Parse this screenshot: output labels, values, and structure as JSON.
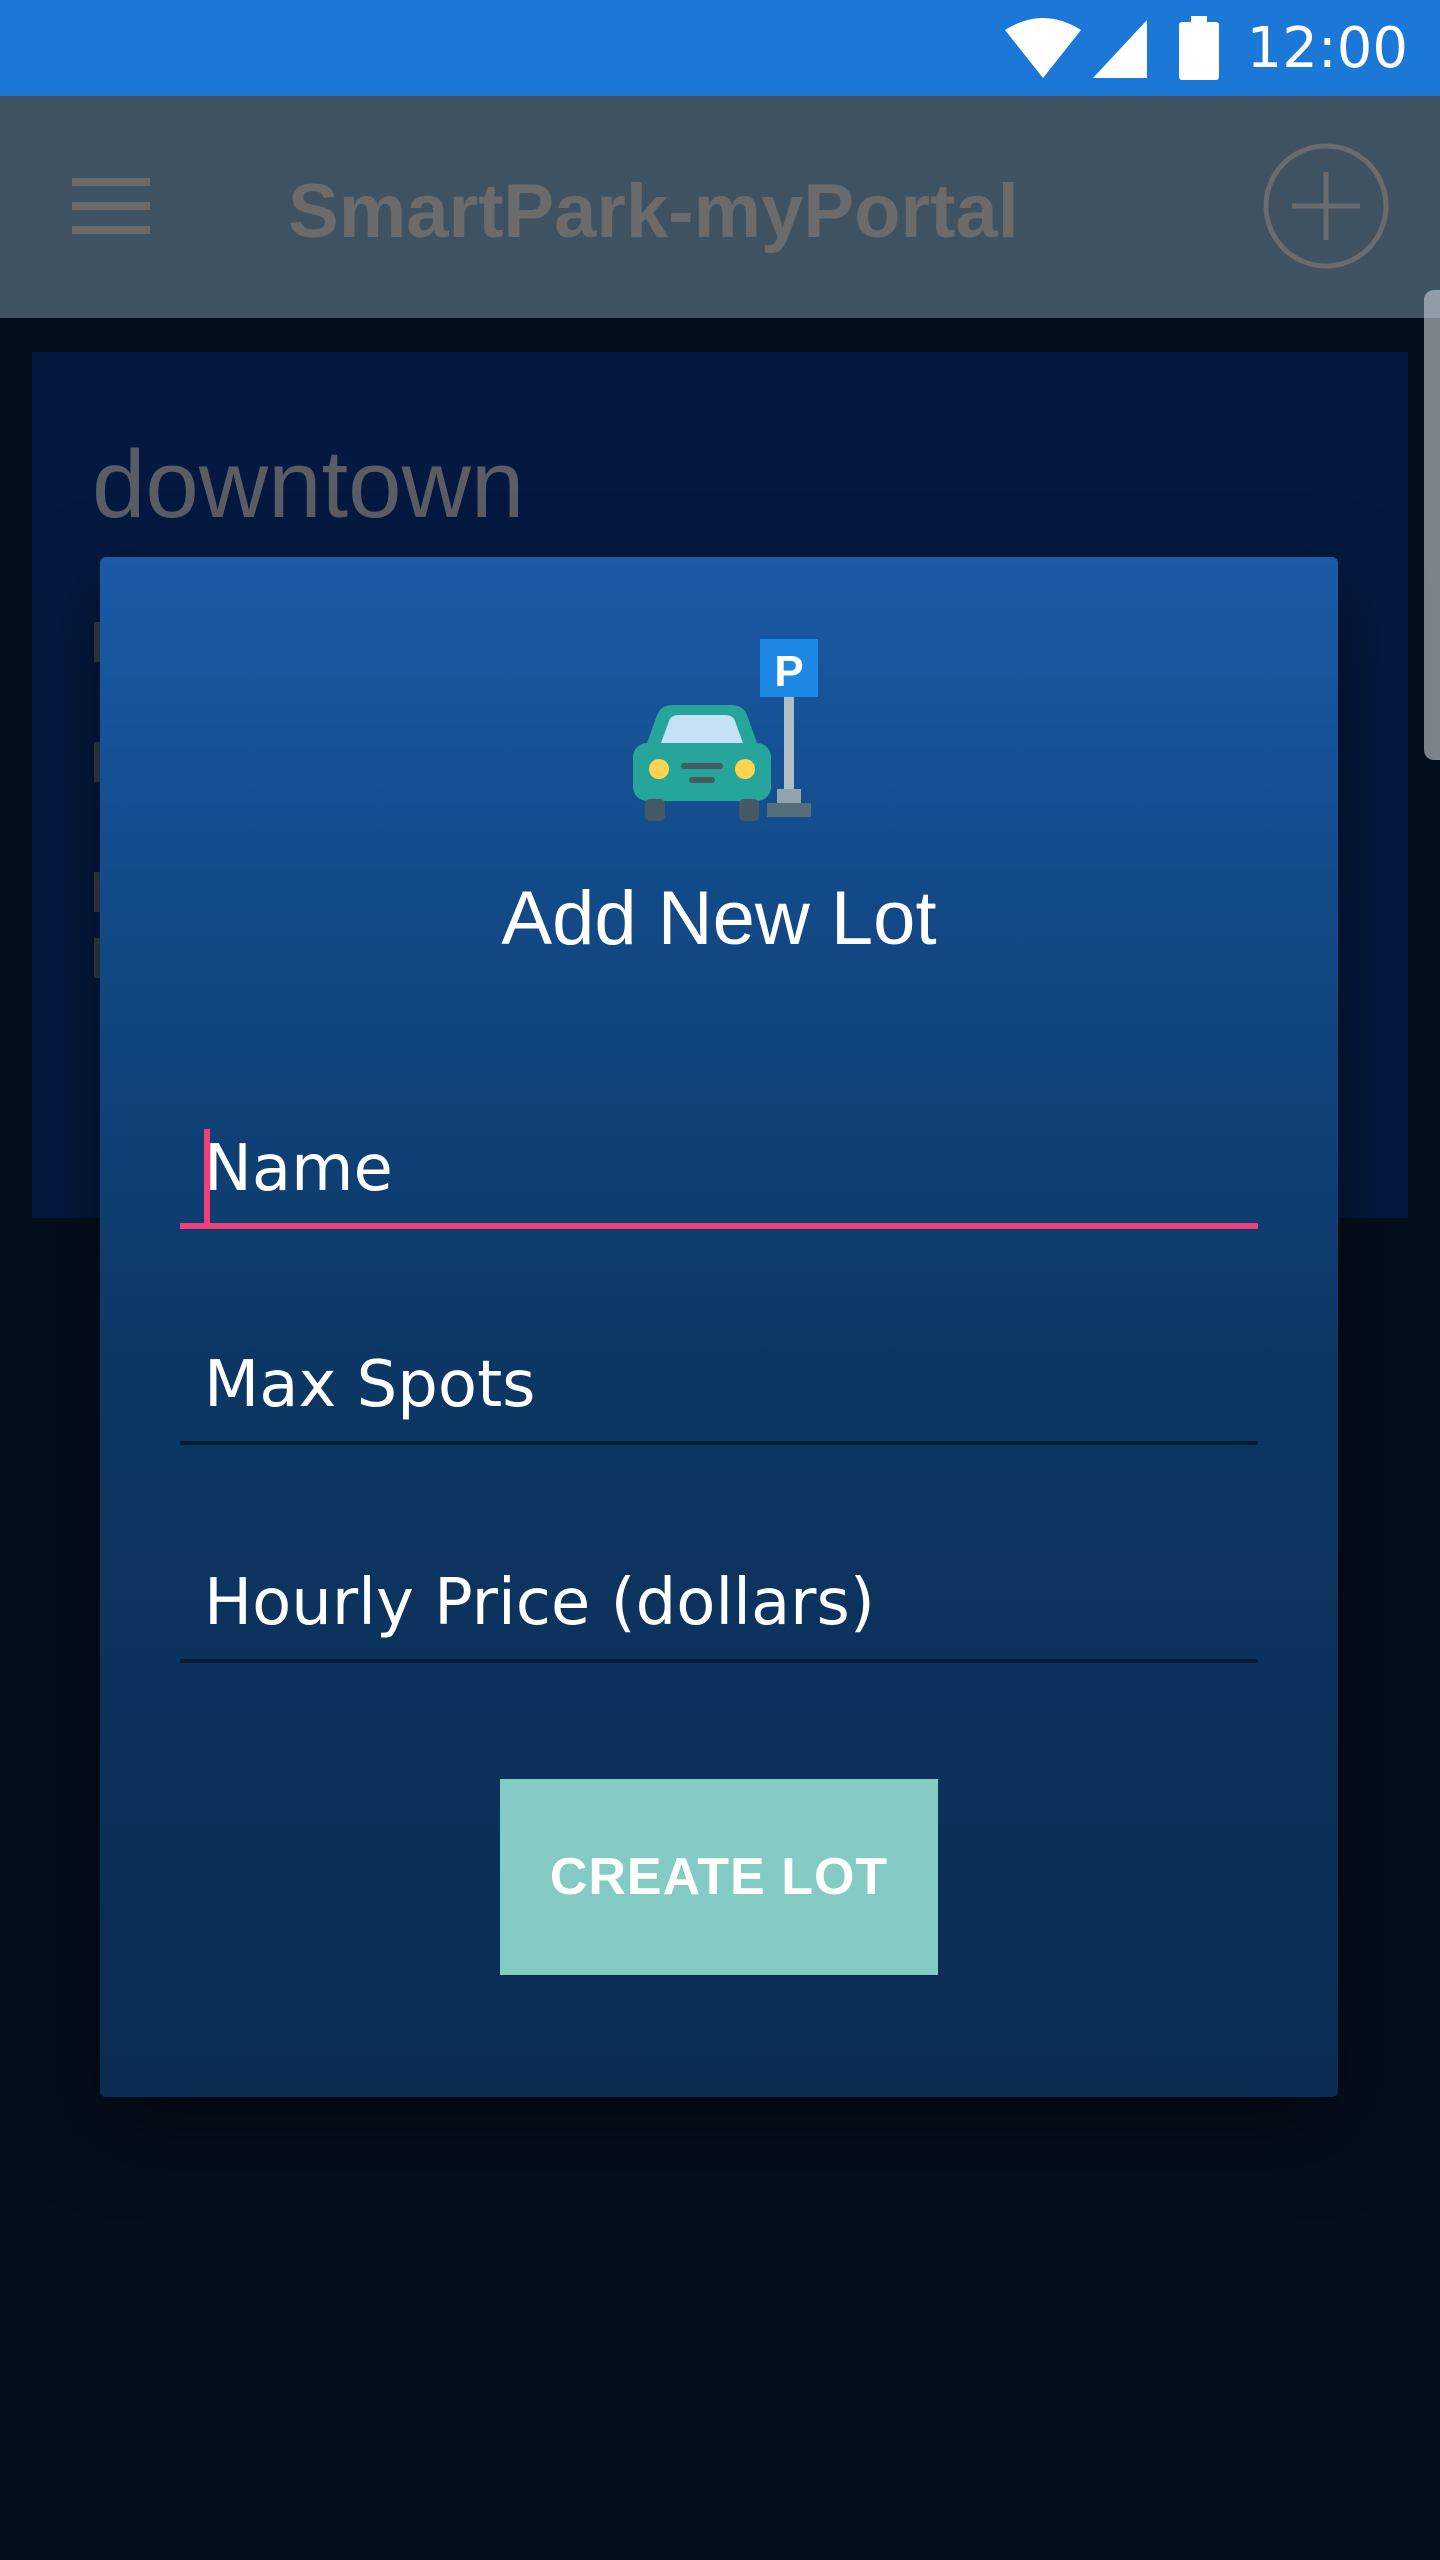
{
  "status_bar": {
    "time": "12:00",
    "icons": [
      "wifi-icon",
      "signal-icon",
      "battery-icon"
    ],
    "color": "#1b78d6"
  },
  "toolbar": {
    "title": "SmartPark-myPortal",
    "menu_icon": "menu-icon",
    "add_icon": "add-circle-icon"
  },
  "background_card": {
    "title": "downtown"
  },
  "dialog": {
    "icon": "parked-car-icon",
    "icon_sign_letter": "P",
    "title": "Add New Lot",
    "fields": [
      {
        "name": "name",
        "placeholder": "Name",
        "value": "",
        "focused": true
      },
      {
        "name": "max_spots",
        "placeholder": "Max Spots",
        "value": "",
        "focused": false
      },
      {
        "name": "hourly_price",
        "placeholder": "Hourly Price (dollars)",
        "value": "",
        "focused": false
      }
    ],
    "submit_label": "CREATE LOT"
  },
  "colors": {
    "accent": "#ee3f78",
    "button": "#84cbc4",
    "dialog_top": "#1a5ba6",
    "dialog_bottom": "#0a2c52"
  }
}
